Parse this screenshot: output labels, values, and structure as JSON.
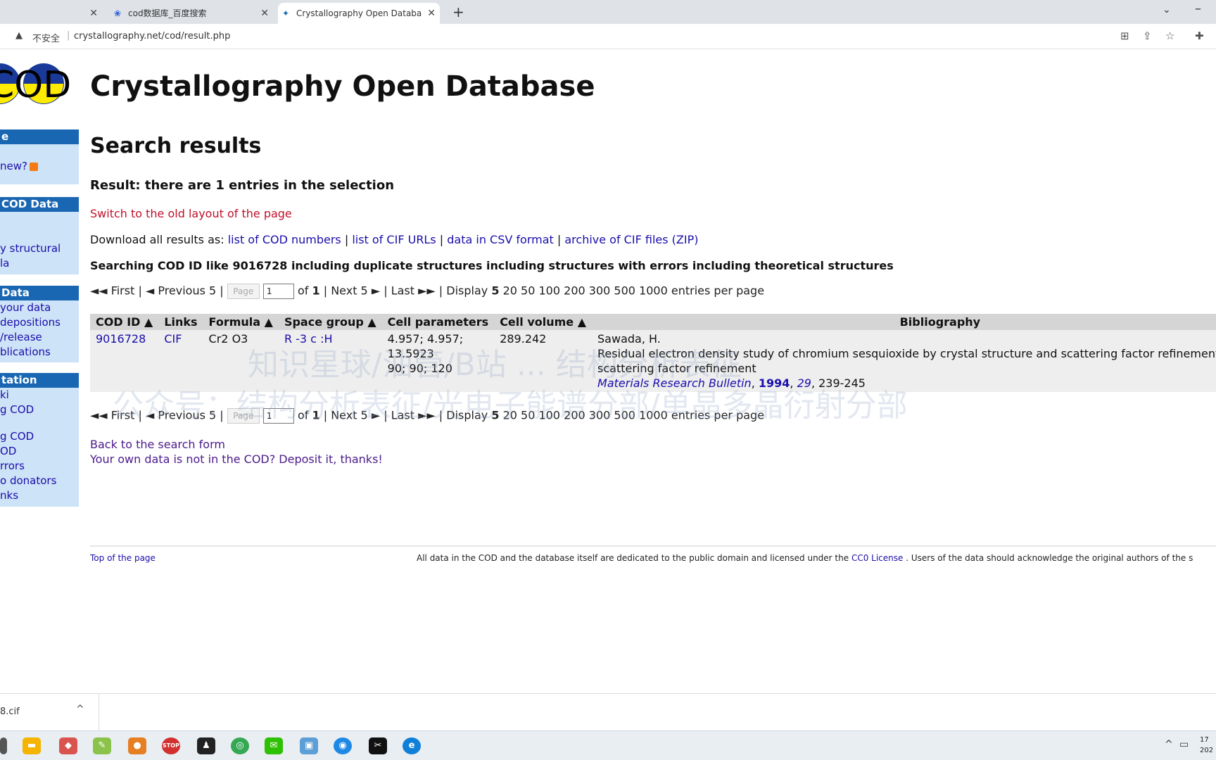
{
  "browser": {
    "tabs": [
      {
        "title": "",
        "close": "✕"
      },
      {
        "title": "cod数据库_百度搜索",
        "close": "✕"
      },
      {
        "title": "Crystallography Open Databa",
        "close": "✕"
      }
    ],
    "new_tab": "+",
    "security_label": "不安全",
    "url": "crystallography.net/cod/result.php"
  },
  "site": {
    "logo_text": "COD",
    "title": "Crystallography Open Database"
  },
  "sidebar": [
    {
      "head": "e",
      "items": [
        "new?"
      ]
    },
    {
      "head": "COD Data",
      "items": [
        "y structural",
        "la"
      ]
    },
    {
      "head": "Data",
      "items": [
        "your data",
        "depositions",
        "/release",
        "blications"
      ]
    },
    {
      "head": "tation",
      "items": [
        "ki",
        "g COD",
        "g COD",
        "OD",
        "rrors",
        "o donators",
        "nks"
      ]
    }
  ],
  "main": {
    "heading": "Search results",
    "result_count": "Result: there are 1 entries in the selection",
    "old_layout_link": "Switch to the old layout of the page",
    "download_prefix": "Download all results as:",
    "download_links": [
      "list of COD numbers",
      "list of CIF URLs",
      "data in CSV format",
      "archive of CIF files (ZIP)"
    ],
    "search_description": "Searching COD ID like 9016728 including duplicate structures including structures with errors including theoretical structures",
    "pager": {
      "first": "◄◄ First",
      "previous": "◄ Previous 5",
      "page_button": "Page",
      "page_value": "1",
      "of": "of",
      "total": "1",
      "next": "Next 5 ►",
      "last": "Last ►►",
      "display": "Display",
      "current_size": "5",
      "sizes": [
        "20",
        "50",
        "100",
        "200",
        "300",
        "500",
        "1000"
      ],
      "suffix": "entries per page"
    },
    "table": {
      "headers": [
        "COD ID ▲",
        "Links",
        "Formula ▲",
        "Space group ▲",
        "Cell parameters",
        "Cell volume ▲",
        "Bibliography"
      ],
      "row": {
        "cod_id": "9016728",
        "link": "CIF",
        "formula": "Cr2 O3",
        "space_group": "R -3 c :H",
        "cell_params_1": "4.957; 4.957;",
        "cell_params_2": "13.5923",
        "cell_params_3": "90; 90; 120",
        "cell_volume": "289.242",
        "authors": "Sawada, H.",
        "title_line1": "Residual electron density study of chromium sesquioxide by crystal structure and scattering factor refinement Note: aton",
        "title_line2": "scattering factor refinement",
        "journal": "Materials Research Bulletin",
        "year": "1994",
        "volume": "29",
        "pages": "239-245"
      }
    },
    "back_link": "Back to the search form",
    "deposit_link": "Your own data is not in the COD? Deposit it, thanks!"
  },
  "footer": {
    "top_link": "Top of the page",
    "license_prefix": "All data in the COD and the database itself are dedicated to the public domain and licensed under the",
    "license_link": "CC0 License",
    "license_suffix": ". Users of the data should acknowledge the original authors of the s"
  },
  "watermark": {
    "line1": "知识星球/油管/B站 ... 结构分析表征",
    "line2": "公众号：结构分析表征/光电子能谱分部/单晶多晶衍射分部"
  },
  "download_bar": {
    "file": "8.cif",
    "chevron": "^"
  },
  "taskbar": {
    "clock_time": "17",
    "clock_date": "202"
  }
}
